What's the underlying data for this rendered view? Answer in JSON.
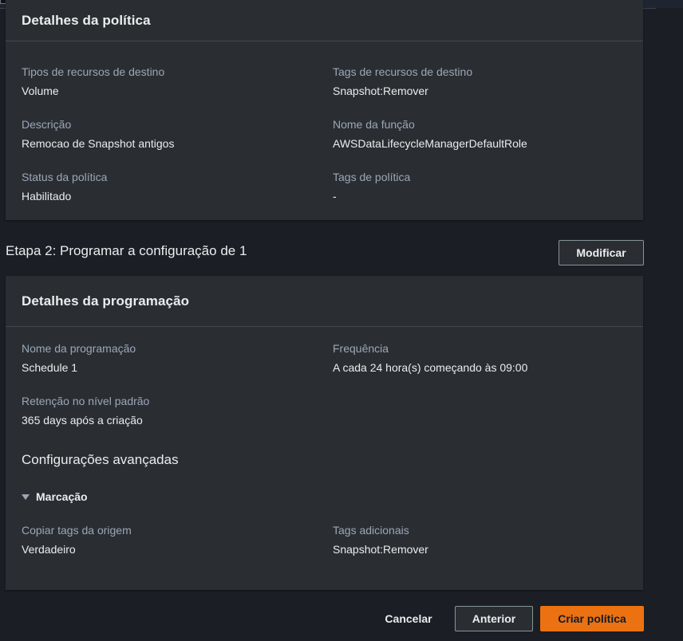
{
  "policy_details": {
    "title": "Detalhes da política",
    "fields": [
      {
        "label": "Tipos de recursos de destino",
        "value": "Volume"
      },
      {
        "label": "Tags de recursos de destino",
        "value": "Snapshot:Remover"
      },
      {
        "label": "Descrição",
        "value": "Remocao de Snapshot antigos"
      },
      {
        "label": "Nome da função",
        "value": "AWSDataLifecycleManagerDefaultRole"
      },
      {
        "label": "Status da política",
        "value": "Habilitado"
      },
      {
        "label": "Tags de política",
        "value": "-"
      }
    ]
  },
  "step2": {
    "title": "Etapa 2: Programar a configuração de 1",
    "modify_label": "Modificar"
  },
  "schedule_details": {
    "title": "Detalhes da programação",
    "fields": [
      {
        "label": "Nome da programação",
        "value": "Schedule 1"
      },
      {
        "label": "Frequência",
        "value": "A cada 24 hora(s) começando às 09:00"
      },
      {
        "label": "Retenção no nível padrão",
        "value": "365 days após a criação"
      }
    ],
    "advanced_heading": "Configurações avançadas",
    "tagging_label": "Marcação",
    "tag_fields": [
      {
        "label": "Copiar tags da origem",
        "value": "Verdadeiro"
      },
      {
        "label": "Tags adicionais",
        "value": "Snapshot:Remover"
      }
    ]
  },
  "footer": {
    "cancel_label": "Cancelar",
    "previous_label": "Anterior",
    "create_label": "Criar política"
  },
  "colors": {
    "primary": "#ec7211",
    "panel": "#2a2e33",
    "background": "#1b1e25"
  }
}
